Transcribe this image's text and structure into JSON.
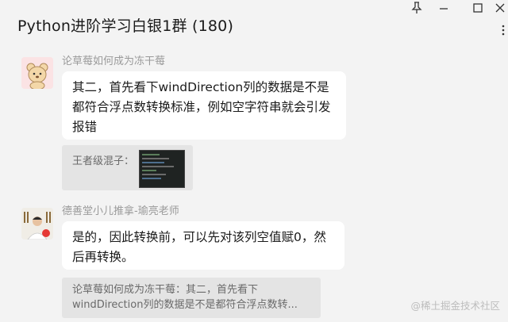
{
  "window": {
    "title": "Python进阶学习白银1群 (180)",
    "pin_icon": "pin-icon",
    "minimize_icon": "minimize-icon",
    "maximize_icon": "maximize-icon",
    "close_icon": "close-icon",
    "more_icon": "more-icon"
  },
  "messages": [
    {
      "sender": "论草莓如何成为冻干莓",
      "text": "其二，首先看下windDirection列的数据是不是都符合浮点数转换标准，例如空字符串就会引发报错",
      "quote": {
        "author_prefix": "王者级混子：",
        "has_image": true
      }
    },
    {
      "sender": "德善堂小儿推拿-瑜亮老师",
      "text": "是的，因此转换前，可以先对该列空值赋0，然后再转换。",
      "quote": {
        "line1": "论草莓如何成为冻干莓：其二，首先看下",
        "line2": "windDirection列的数据是不是都符合浮点数转..."
      }
    }
  ],
  "watermark": "@稀土掘金技术社区",
  "colors": {
    "background": "#f3f3f3",
    "bubble": "#ffffff",
    "quote": "#e4e4e4",
    "sender_text": "#9a9a9a"
  }
}
